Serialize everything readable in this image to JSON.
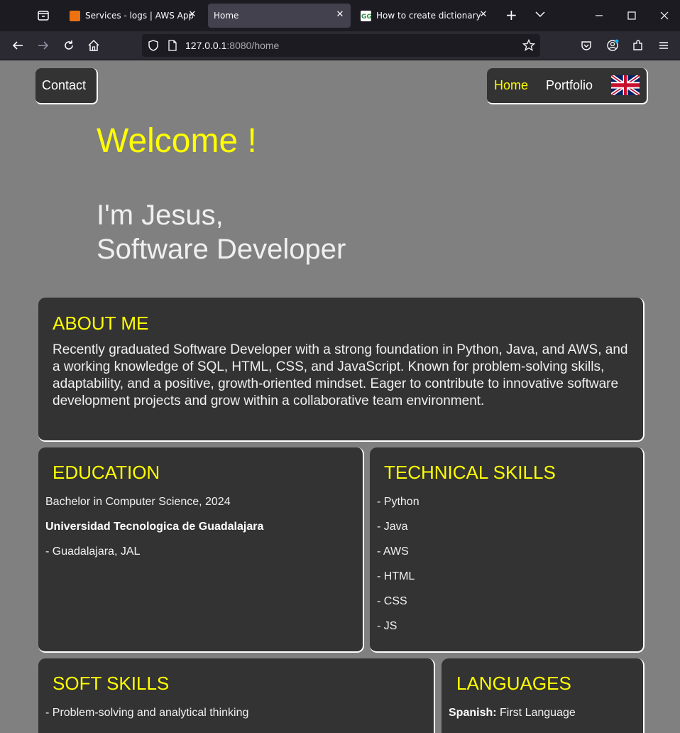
{
  "browser": {
    "tabs": [
      {
        "title": "Services - logs | AWS App Runner",
        "favicon_color": "#ec7211",
        "active": false
      },
      {
        "title": "Home",
        "favicon_color": "",
        "active": true
      },
      {
        "title": "How to create dictionary and add",
        "favicon_color": "#2f8d46",
        "active": false
      }
    ],
    "url": {
      "host": "127.0.0.1",
      "rest": ":8080/home"
    }
  },
  "nav": {
    "contact": "Contact",
    "home": "Home",
    "portfolio": "Portfolio"
  },
  "hero": {
    "welcome": "Welcome !",
    "line1": "I'm Jesus,",
    "line2": "Software Developer"
  },
  "about": {
    "title": "ABOUT ME",
    "text": "Recently graduated Software Developer with a strong foundation in Python, Java, and AWS, and a working knowledge of SQL, HTML, CSS, and JavaScript. Known for problem-solving skills, adaptability, and a positive, growth-oriented mindset. Eager to contribute to innovative software development projects and grow within a collaborative team environment."
  },
  "education": {
    "title": "EDUCATION",
    "degree": "Bachelor in Computer Science, 2024",
    "school": "Universidad Tecnologica de Guadalajara",
    "location": "- Guadalajara, JAL"
  },
  "technical": {
    "title": "TECHNICAL SKILLS",
    "items": [
      "- Python",
      "- Java",
      "- AWS",
      "- HTML",
      "- CSS",
      "- JS"
    ]
  },
  "soft": {
    "title": "SOFT SKILLS",
    "items": [
      "- Problem-solving and analytical thinking"
    ]
  },
  "languages": {
    "title": "LANGUAGES",
    "items": [
      {
        "name": "Spanish:",
        "level": "First Language"
      }
    ]
  },
  "colors": {
    "accent": "#ffff00",
    "card": "#333333",
    "page": "#808080"
  }
}
